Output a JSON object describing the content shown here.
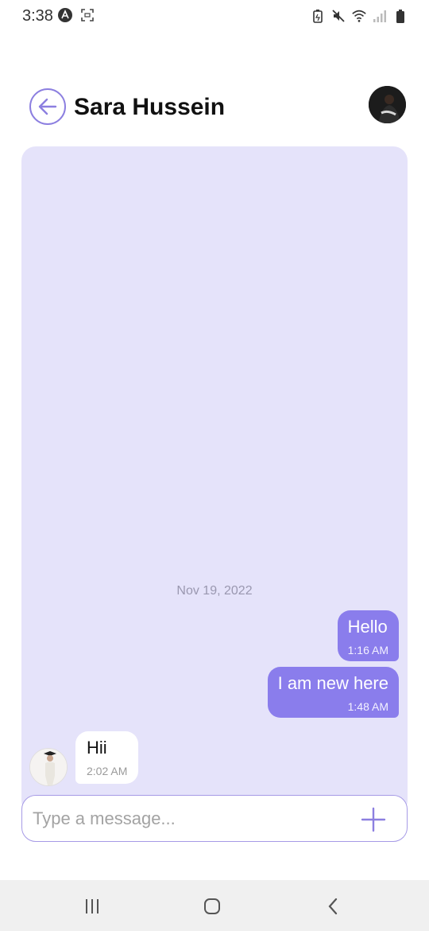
{
  "status_bar": {
    "time": "3:38",
    "left_icons": [
      "app-a-icon",
      "screenshot-icon"
    ],
    "right_icons": [
      "battery-saver-icon",
      "mute-icon",
      "wifi-icon",
      "signal-icon",
      "battery-icon"
    ]
  },
  "header": {
    "contact_name": "Sara Hussein",
    "back_icon": "arrow-left-icon"
  },
  "chat": {
    "date_separator": "Nov 19, 2022",
    "messages": [
      {
        "direction": "outgoing",
        "text": "Hello",
        "time": "1:16 AM"
      },
      {
        "direction": "outgoing",
        "text": "I am new here",
        "time": "1:48 AM"
      },
      {
        "direction": "incoming",
        "text": "Hii",
        "time": "2:02 AM"
      }
    ]
  },
  "composer": {
    "placeholder": "Type a message...",
    "value": "",
    "add_icon": "plus-icon"
  },
  "nav": {
    "icons": [
      "recent-apps-icon",
      "home-icon",
      "back-icon"
    ]
  },
  "colors": {
    "accent": "#8a7dec",
    "chat_background": "#e5e3fa",
    "outline": "#8c7fe0"
  }
}
